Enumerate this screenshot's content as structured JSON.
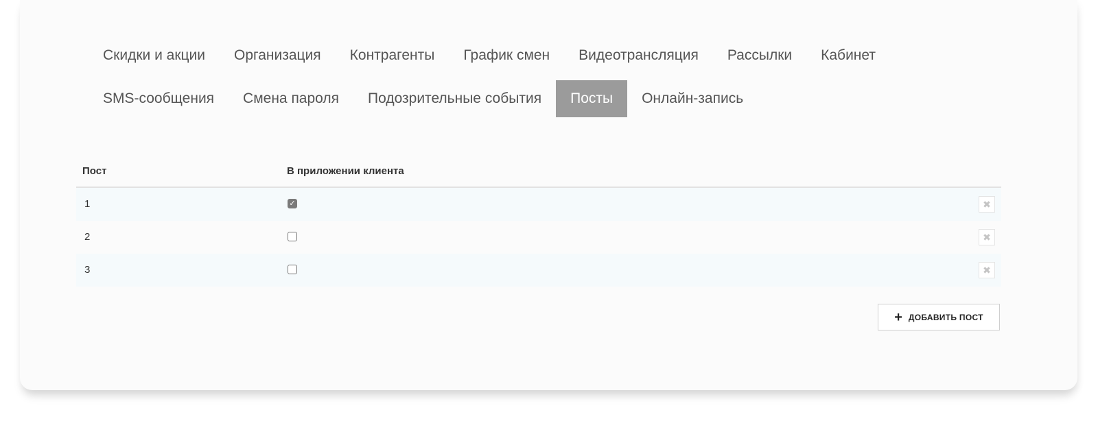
{
  "tabs": {
    "row1": [
      {
        "label": "Скидки и акции"
      },
      {
        "label": "Организация"
      },
      {
        "label": "Контрагенты"
      },
      {
        "label": "График смен"
      },
      {
        "label": "Видеотрансляция"
      },
      {
        "label": "Рассылки"
      },
      {
        "label": "Кабинет"
      }
    ],
    "row2": [
      {
        "label": "SMS-сообщения"
      },
      {
        "label": "Смена пароля"
      },
      {
        "label": "Подозрительные события"
      },
      {
        "label": "Посты",
        "active": true
      },
      {
        "label": "Онлайн-запись"
      }
    ]
  },
  "table": {
    "headers": {
      "post": "Пост",
      "in_client_app": "В приложении клиента"
    },
    "rows": [
      {
        "post": "1",
        "in_client_app": true
      },
      {
        "post": "2",
        "in_client_app": false
      },
      {
        "post": "3",
        "in_client_app": false
      }
    ]
  },
  "icons": {
    "delete": "close-icon",
    "add": "plus-icon",
    "check": "check-icon"
  },
  "add_button": {
    "label": "ДОБАВИТЬ ПОСТ"
  },
  "colors": {
    "active_tab_bg": "#9b9b9b",
    "checked_bg": "#7a7a7a"
  }
}
